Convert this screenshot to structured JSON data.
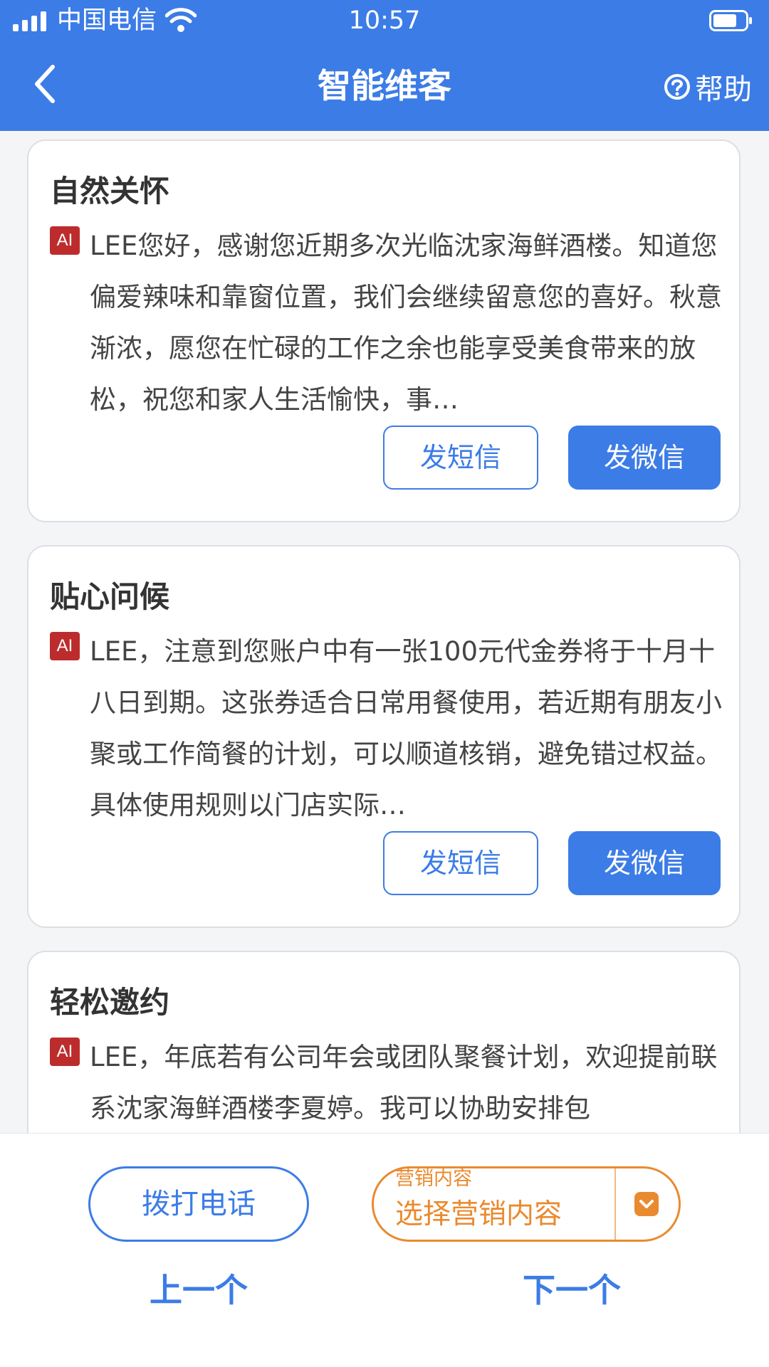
{
  "status_bar": {
    "carrier": "中国电信",
    "time": "10:57",
    "icons": [
      "signal-icon",
      "wifi-icon",
      "battery-icon"
    ]
  },
  "header": {
    "title": "智能维客",
    "help_label": "帮助",
    "icons": [
      "back-arrow-icon",
      "help-circle-icon"
    ]
  },
  "cards": [
    {
      "title": "自然关怀",
      "badge": "AI",
      "text": "LEE您好，感谢您近期多次光临沈家海鲜酒楼。知道您偏爱辣味和靠窗位置，我们会继续留意您的喜好。秋意渐浓，愿您在忙碌的工作之余也能享受美食带来的放松，祝您和家人生活愉快，事…",
      "sms_label": "发短信",
      "wechat_label": "发微信"
    },
    {
      "title": "贴心问候",
      "badge": "AI",
      "text": "LEE，注意到您账户中有一张100元代金券将于十月十八日到期。这张券适合日常用餐使用，若近期有朋友小聚或工作简餐的计划，可以顺道核销，避免错过权益。具体使用规则以门店实际…",
      "sms_label": "发短信",
      "wechat_label": "发微信"
    },
    {
      "title": "轻松邀约",
      "badge": "AI",
      "text": "LEE，年底若有公司年会或团队聚餐计划，欢迎提前联系沈家海鲜酒楼李夏婷。我可以协助安排包",
      "sms_label": "",
      "wechat_label": ""
    }
  ],
  "footer": {
    "call_label": "拨打电话",
    "select_label": "营销内容",
    "select_value": "选择营销内容",
    "prev_label": "上一个",
    "next_label": "下一个"
  },
  "colors": {
    "primary": "#3c7ce6",
    "accent": "#ea8a2e",
    "badge": "#bd2c2c"
  }
}
